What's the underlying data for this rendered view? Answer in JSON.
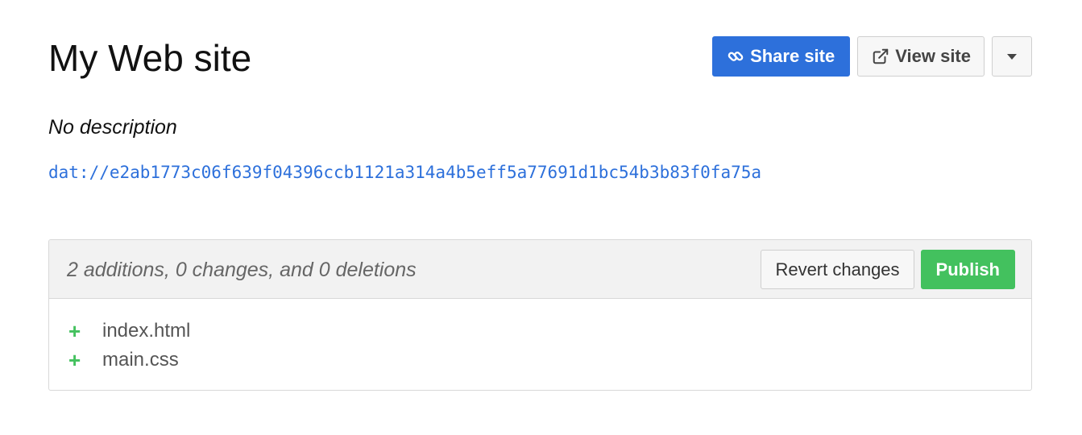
{
  "site": {
    "title": "My Web site",
    "description": "No description",
    "url": "dat://e2ab1773c06f639f04396ccb1121a314a4b5eff5a77691d1bc54b3b83f0fa75a"
  },
  "actions": {
    "share_label": "Share site",
    "share_icon": "link-icon",
    "view_label": "View site",
    "view_icon": "external-link-icon",
    "more_icon": "caret-down-icon"
  },
  "changes": {
    "summary": "2 additions, 0 changes, and 0 deletions",
    "revert_label": "Revert changes",
    "publish_label": "Publish",
    "files": [
      {
        "status": "+",
        "name": "index.html"
      },
      {
        "status": "+",
        "name": "main.css"
      }
    ]
  },
  "colors": {
    "primary": "#2d70db",
    "success": "#43c15e",
    "link": "#2d70db"
  }
}
